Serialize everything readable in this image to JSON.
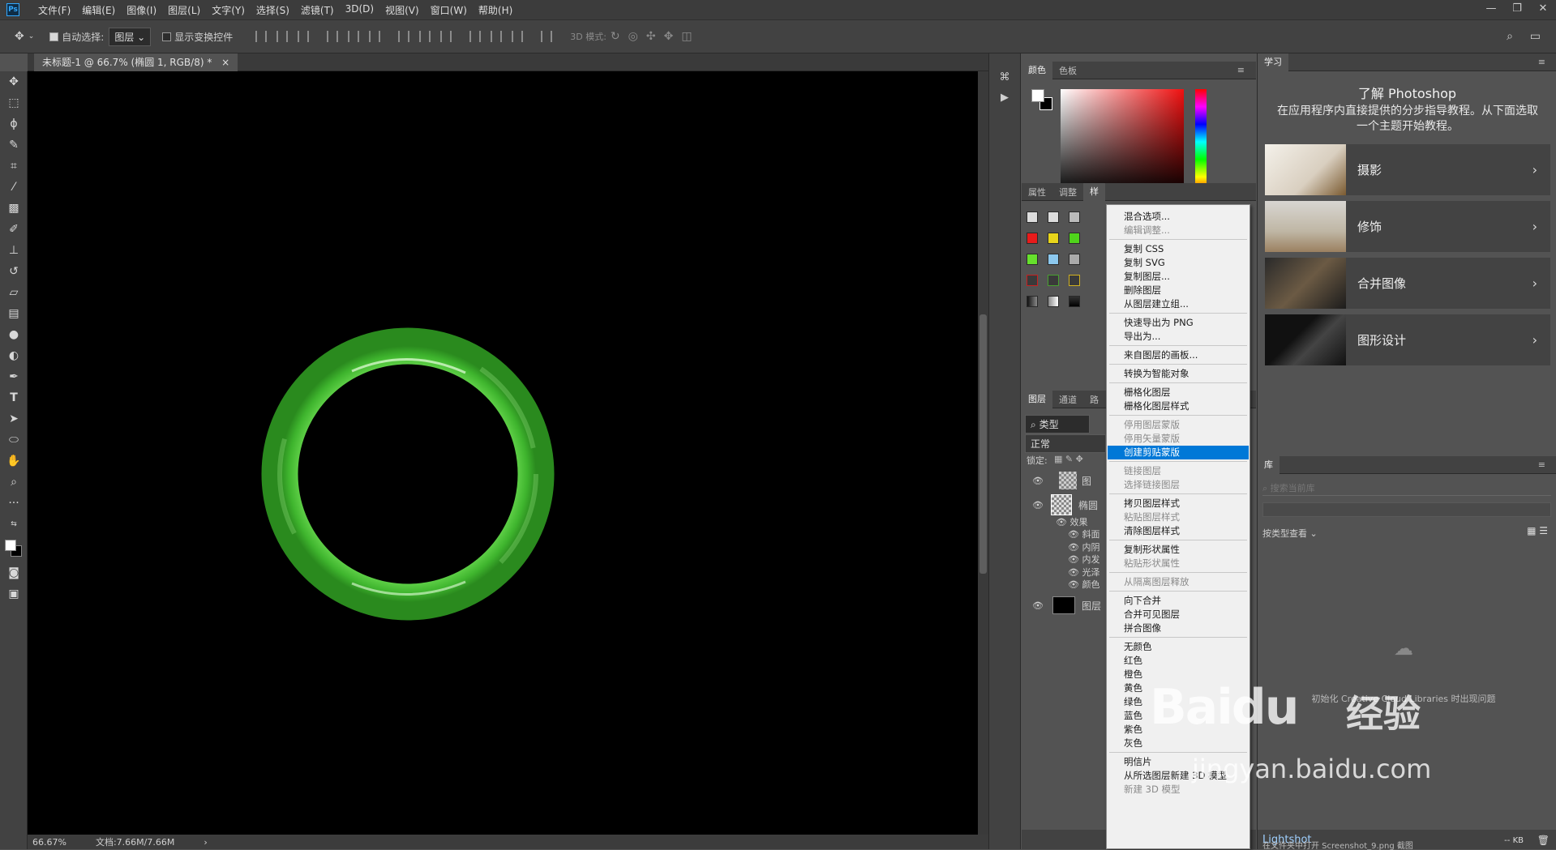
{
  "app": {
    "logo": "Ps"
  },
  "menubar": {
    "items": [
      "文件(F)",
      "编辑(E)",
      "图像(I)",
      "图层(L)",
      "文字(Y)",
      "选择(S)",
      "滤镜(T)",
      "3D(D)",
      "视图(V)",
      "窗口(W)",
      "帮助(H)"
    ]
  },
  "window_controls": {
    "minimize": "—",
    "restore": "❐",
    "close": "✕"
  },
  "options_bar": {
    "auto_select_label": "自动选择:",
    "auto_select_value": "图层",
    "show_transform_label": "显示变换控件",
    "mode_3d_label": "3D 模式:"
  },
  "document": {
    "tab_title": "未标题-1 @ 66.7% (椭圆 1, RGB/8) *",
    "close": "×",
    "zoom": "66.67%",
    "doc_info": "文档:7.66M/7.66M",
    "arrow": "›"
  },
  "color_panel": {
    "tabs": [
      "颜色",
      "色板"
    ]
  },
  "props_panel": {
    "tabs": [
      "属性",
      "调整",
      "样"
    ]
  },
  "layers_panel": {
    "tabs": [
      "图层",
      "通道",
      "路"
    ],
    "filter_label": "类型",
    "blend_mode": "正常",
    "lock_label": "锁定:",
    "layers": [
      {
        "name": "图",
        "visible_icon": "●"
      },
      {
        "name": "椭圆",
        "visible_icon": "●"
      },
      {
        "name": "图层",
        "visible_icon": "●"
      }
    ],
    "effects_label": "效果",
    "effects": [
      "斜面",
      "内阴",
      "内发",
      "光泽",
      "颜色"
    ]
  },
  "context_menu": {
    "groups": [
      [
        {
          "label": "混合选项...",
          "disabled": false
        },
        {
          "label": "编辑调整...",
          "disabled": true
        }
      ],
      [
        {
          "label": "复制 CSS",
          "disabled": false
        },
        {
          "label": "复制 SVG",
          "disabled": false
        },
        {
          "label": "复制图层...",
          "disabled": false
        },
        {
          "label": "删除图层",
          "disabled": false
        },
        {
          "label": "从图层建立组...",
          "disabled": false
        }
      ],
      [
        {
          "label": "快速导出为 PNG",
          "disabled": false
        },
        {
          "label": "导出为...",
          "disabled": false
        }
      ],
      [
        {
          "label": "来自图层的画板...",
          "disabled": false
        }
      ],
      [
        {
          "label": "转换为智能对象",
          "disabled": false
        }
      ],
      [
        {
          "label": "栅格化图层",
          "disabled": false
        },
        {
          "label": "栅格化图层样式",
          "disabled": false
        }
      ],
      [
        {
          "label": "停用图层蒙版",
          "disabled": true
        },
        {
          "label": "停用矢量蒙版",
          "disabled": true
        },
        {
          "label": "创建剪贴蒙版",
          "disabled": false,
          "highlight": true
        }
      ],
      [
        {
          "label": "链接图层",
          "disabled": true
        },
        {
          "label": "选择链接图层",
          "disabled": true
        }
      ],
      [
        {
          "label": "拷贝图层样式",
          "disabled": false
        },
        {
          "label": "粘贴图层样式",
          "disabled": true
        },
        {
          "label": "清除图层样式",
          "disabled": false
        }
      ],
      [
        {
          "label": "复制形状属性",
          "disabled": false
        },
        {
          "label": "粘贴形状属性",
          "disabled": true
        }
      ],
      [
        {
          "label": "从隔离图层释放",
          "disabled": true
        }
      ],
      [
        {
          "label": "向下合并",
          "disabled": false
        },
        {
          "label": "合并可见图层",
          "disabled": false
        },
        {
          "label": "拼合图像",
          "disabled": false
        }
      ],
      [
        {
          "label": "无颜色",
          "disabled": false
        },
        {
          "label": "红色",
          "disabled": false
        },
        {
          "label": "橙色",
          "disabled": false
        },
        {
          "label": "黄色",
          "disabled": false
        },
        {
          "label": "绿色",
          "disabled": false
        },
        {
          "label": "蓝色",
          "disabled": false
        },
        {
          "label": "紫色",
          "disabled": false
        },
        {
          "label": "灰色",
          "disabled": false
        }
      ],
      [
        {
          "label": "明信片",
          "disabled": false
        },
        {
          "label": "从所选图层新建 3D 模型",
          "disabled": false
        },
        {
          "label": "新建 3D 模型",
          "disabled": true
        }
      ]
    ]
  },
  "learn_panel": {
    "tab": "学习",
    "title": "了解 Photoshop",
    "description": "在应用程序内直接提供的分步指导教程。从下面选取一个主题开始教程。",
    "cards": [
      {
        "label": "摄影"
      },
      {
        "label": "修饰"
      },
      {
        "label": "合并图像"
      },
      {
        "label": "图形设计"
      }
    ]
  },
  "library_panel": {
    "tab": "库",
    "search_placeholder": "搜索当前库",
    "view_label": "按类型查看",
    "error_text": "Creative Cloud Libraries 时出现问题",
    "error_prefix": "初始化"
  },
  "lightshot_notification": {
    "title": "Lightshot",
    "text": "在文件夹中打开 Screenshot_9.png 截图",
    "kb": "-- KB"
  },
  "watermark": {
    "logo_text": "Baidu",
    "jingyan": "经验",
    "url": "jingyan.baidu.com"
  },
  "colors": {
    "ring_green": "#3fb52e",
    "menu_highlight": "#0078d7"
  }
}
